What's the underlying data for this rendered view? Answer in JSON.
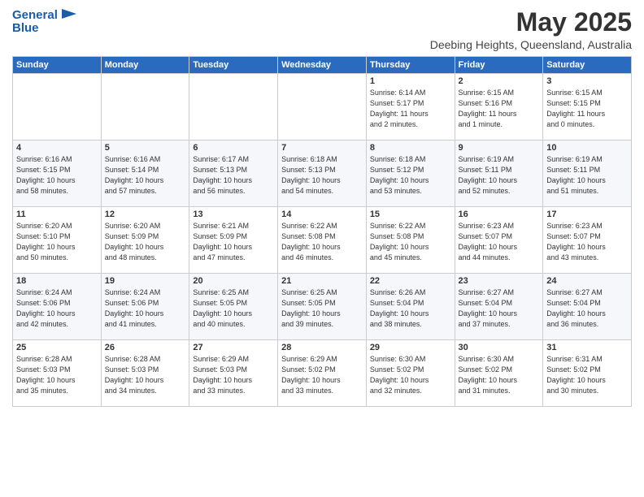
{
  "header": {
    "logo_line1": "General",
    "logo_line2": "Blue",
    "title": "May 2025",
    "subtitle": "Deebing Heights, Queensland, Australia"
  },
  "columns": [
    "Sunday",
    "Monday",
    "Tuesday",
    "Wednesday",
    "Thursday",
    "Friday",
    "Saturday"
  ],
  "weeks": [
    [
      {
        "day": "",
        "info": ""
      },
      {
        "day": "",
        "info": ""
      },
      {
        "day": "",
        "info": ""
      },
      {
        "day": "",
        "info": ""
      },
      {
        "day": "1",
        "info": "Sunrise: 6:14 AM\nSunset: 5:17 PM\nDaylight: 11 hours\nand 2 minutes."
      },
      {
        "day": "2",
        "info": "Sunrise: 6:15 AM\nSunset: 5:16 PM\nDaylight: 11 hours\nand 1 minute."
      },
      {
        "day": "3",
        "info": "Sunrise: 6:15 AM\nSunset: 5:15 PM\nDaylight: 11 hours\nand 0 minutes."
      }
    ],
    [
      {
        "day": "4",
        "info": "Sunrise: 6:16 AM\nSunset: 5:15 PM\nDaylight: 10 hours\nand 58 minutes."
      },
      {
        "day": "5",
        "info": "Sunrise: 6:16 AM\nSunset: 5:14 PM\nDaylight: 10 hours\nand 57 minutes."
      },
      {
        "day": "6",
        "info": "Sunrise: 6:17 AM\nSunset: 5:13 PM\nDaylight: 10 hours\nand 56 minutes."
      },
      {
        "day": "7",
        "info": "Sunrise: 6:18 AM\nSunset: 5:13 PM\nDaylight: 10 hours\nand 54 minutes."
      },
      {
        "day": "8",
        "info": "Sunrise: 6:18 AM\nSunset: 5:12 PM\nDaylight: 10 hours\nand 53 minutes."
      },
      {
        "day": "9",
        "info": "Sunrise: 6:19 AM\nSunset: 5:11 PM\nDaylight: 10 hours\nand 52 minutes."
      },
      {
        "day": "10",
        "info": "Sunrise: 6:19 AM\nSunset: 5:11 PM\nDaylight: 10 hours\nand 51 minutes."
      }
    ],
    [
      {
        "day": "11",
        "info": "Sunrise: 6:20 AM\nSunset: 5:10 PM\nDaylight: 10 hours\nand 50 minutes."
      },
      {
        "day": "12",
        "info": "Sunrise: 6:20 AM\nSunset: 5:09 PM\nDaylight: 10 hours\nand 48 minutes."
      },
      {
        "day": "13",
        "info": "Sunrise: 6:21 AM\nSunset: 5:09 PM\nDaylight: 10 hours\nand 47 minutes."
      },
      {
        "day": "14",
        "info": "Sunrise: 6:22 AM\nSunset: 5:08 PM\nDaylight: 10 hours\nand 46 minutes."
      },
      {
        "day": "15",
        "info": "Sunrise: 6:22 AM\nSunset: 5:08 PM\nDaylight: 10 hours\nand 45 minutes."
      },
      {
        "day": "16",
        "info": "Sunrise: 6:23 AM\nSunset: 5:07 PM\nDaylight: 10 hours\nand 44 minutes."
      },
      {
        "day": "17",
        "info": "Sunrise: 6:23 AM\nSunset: 5:07 PM\nDaylight: 10 hours\nand 43 minutes."
      }
    ],
    [
      {
        "day": "18",
        "info": "Sunrise: 6:24 AM\nSunset: 5:06 PM\nDaylight: 10 hours\nand 42 minutes."
      },
      {
        "day": "19",
        "info": "Sunrise: 6:24 AM\nSunset: 5:06 PM\nDaylight: 10 hours\nand 41 minutes."
      },
      {
        "day": "20",
        "info": "Sunrise: 6:25 AM\nSunset: 5:05 PM\nDaylight: 10 hours\nand 40 minutes."
      },
      {
        "day": "21",
        "info": "Sunrise: 6:25 AM\nSunset: 5:05 PM\nDaylight: 10 hours\nand 39 minutes."
      },
      {
        "day": "22",
        "info": "Sunrise: 6:26 AM\nSunset: 5:04 PM\nDaylight: 10 hours\nand 38 minutes."
      },
      {
        "day": "23",
        "info": "Sunrise: 6:27 AM\nSunset: 5:04 PM\nDaylight: 10 hours\nand 37 minutes."
      },
      {
        "day": "24",
        "info": "Sunrise: 6:27 AM\nSunset: 5:04 PM\nDaylight: 10 hours\nand 36 minutes."
      }
    ],
    [
      {
        "day": "25",
        "info": "Sunrise: 6:28 AM\nSunset: 5:03 PM\nDaylight: 10 hours\nand 35 minutes."
      },
      {
        "day": "26",
        "info": "Sunrise: 6:28 AM\nSunset: 5:03 PM\nDaylight: 10 hours\nand 34 minutes."
      },
      {
        "day": "27",
        "info": "Sunrise: 6:29 AM\nSunset: 5:03 PM\nDaylight: 10 hours\nand 33 minutes."
      },
      {
        "day": "28",
        "info": "Sunrise: 6:29 AM\nSunset: 5:02 PM\nDaylight: 10 hours\nand 33 minutes."
      },
      {
        "day": "29",
        "info": "Sunrise: 6:30 AM\nSunset: 5:02 PM\nDaylight: 10 hours\nand 32 minutes."
      },
      {
        "day": "30",
        "info": "Sunrise: 6:30 AM\nSunset: 5:02 PM\nDaylight: 10 hours\nand 31 minutes."
      },
      {
        "day": "31",
        "info": "Sunrise: 6:31 AM\nSunset: 5:02 PM\nDaylight: 10 hours\nand 30 minutes."
      }
    ]
  ]
}
